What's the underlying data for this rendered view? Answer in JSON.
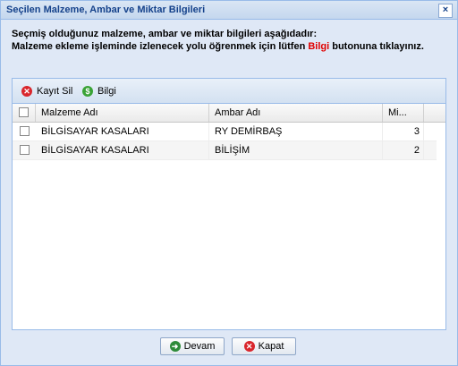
{
  "window": {
    "title": "Seçilen Malzeme, Ambar ve Miktar Bilgileri",
    "close_symbol": "×"
  },
  "info": {
    "line1": "Seçmiş olduğunuz malzeme, ambar ve miktar bilgileri aşağıdadır:",
    "line2_prefix": "Malzeme ekleme işleminde izlenecek yolu öğrenmek için lütfen ",
    "line2_highlight": "Bilgi",
    "line2_suffix": " butonuna tıklayınız.",
    "highlight_color": "#e00000"
  },
  "toolbar": {
    "delete_label": "Kayıt Sil",
    "delete_icon": "delete-icon",
    "delete_symbol": "✕",
    "delete_color": "#d9262c",
    "info_label": "Bilgi",
    "info_icon": "info-icon",
    "info_symbol": "$",
    "info_color": "#3aa336"
  },
  "grid": {
    "columns": [
      "Malzeme Adı",
      "Ambar Adı",
      "Mi..."
    ],
    "rows": [
      {
        "malzeme": "BİLGİSAYAR KASALARI",
        "ambar": "RY DEMİRBAŞ",
        "miktar": "3"
      },
      {
        "malzeme": "BİLGİSAYAR KASALARI",
        "ambar": "BİLİŞİM",
        "miktar": "2"
      }
    ]
  },
  "footer": {
    "continue_label": "Devam",
    "continue_icon": "arrow-right-icon",
    "continue_symbol": "➜",
    "continue_color": "#2e8b3a",
    "close_label": "Kapat",
    "close_icon": "cancel-icon",
    "close_symbol": "✕",
    "close_color": "#d9262c"
  }
}
